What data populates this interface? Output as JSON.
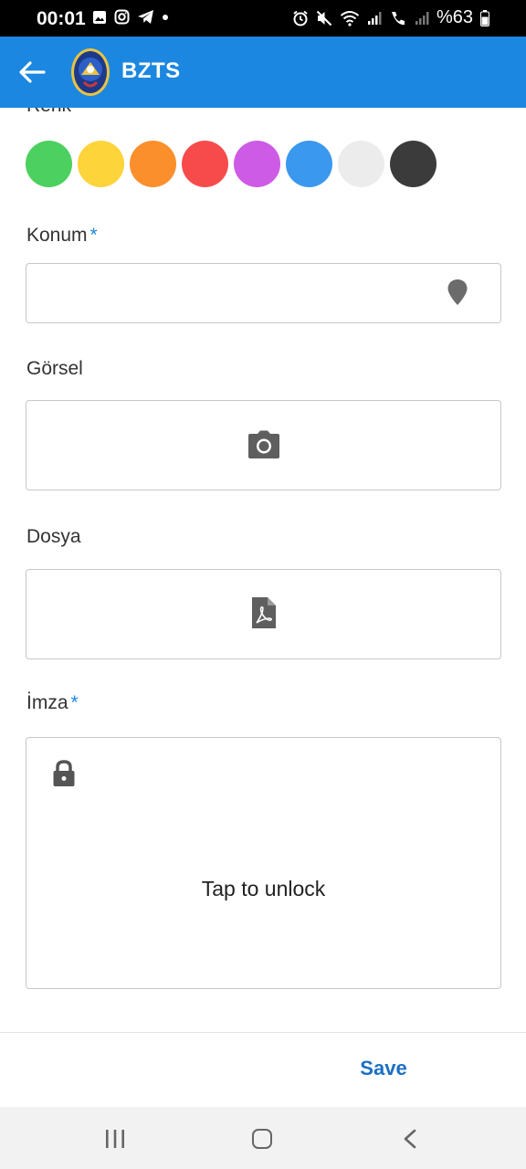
{
  "status_bar": {
    "time": "00:01",
    "battery_text": "%63",
    "left_icons": [
      "gallery-icon",
      "instagram-icon",
      "telegram-icon",
      "dot-icon"
    ],
    "right_icons": [
      "alarm-icon",
      "mute-icon",
      "wifi-icon",
      "signal-icon",
      "call-icon",
      "signal-icon"
    ]
  },
  "app_bar": {
    "title": "BZTS",
    "back_icon": "arrow-left-icon",
    "logo": "municipality-logo"
  },
  "form": {
    "color_label": "Renk",
    "colors": [
      "#4cd05f",
      "#fdd43a",
      "#fb8f2c",
      "#f74b4b",
      "#cd5be6",
      "#3a98ee",
      "#ececec",
      "#3b3b3b"
    ],
    "location": {
      "label": "Konum",
      "required_mark": "*",
      "icon": "location-pin-icon"
    },
    "image": {
      "label": "Görsel",
      "icon": "camera-icon"
    },
    "file": {
      "label": "Dosya",
      "icon": "pdf-file-icon"
    },
    "signature": {
      "label": "İmza",
      "required_mark": "*",
      "lock_icon": "lock-icon",
      "unlock_text": "Tap to unlock"
    }
  },
  "bottom_bar": {
    "save_label": "Save"
  },
  "nav_bar": {
    "icons": [
      "recent-apps-icon",
      "home-icon",
      "back-nav-icon"
    ]
  },
  "accent_color": "#1c87e0"
}
